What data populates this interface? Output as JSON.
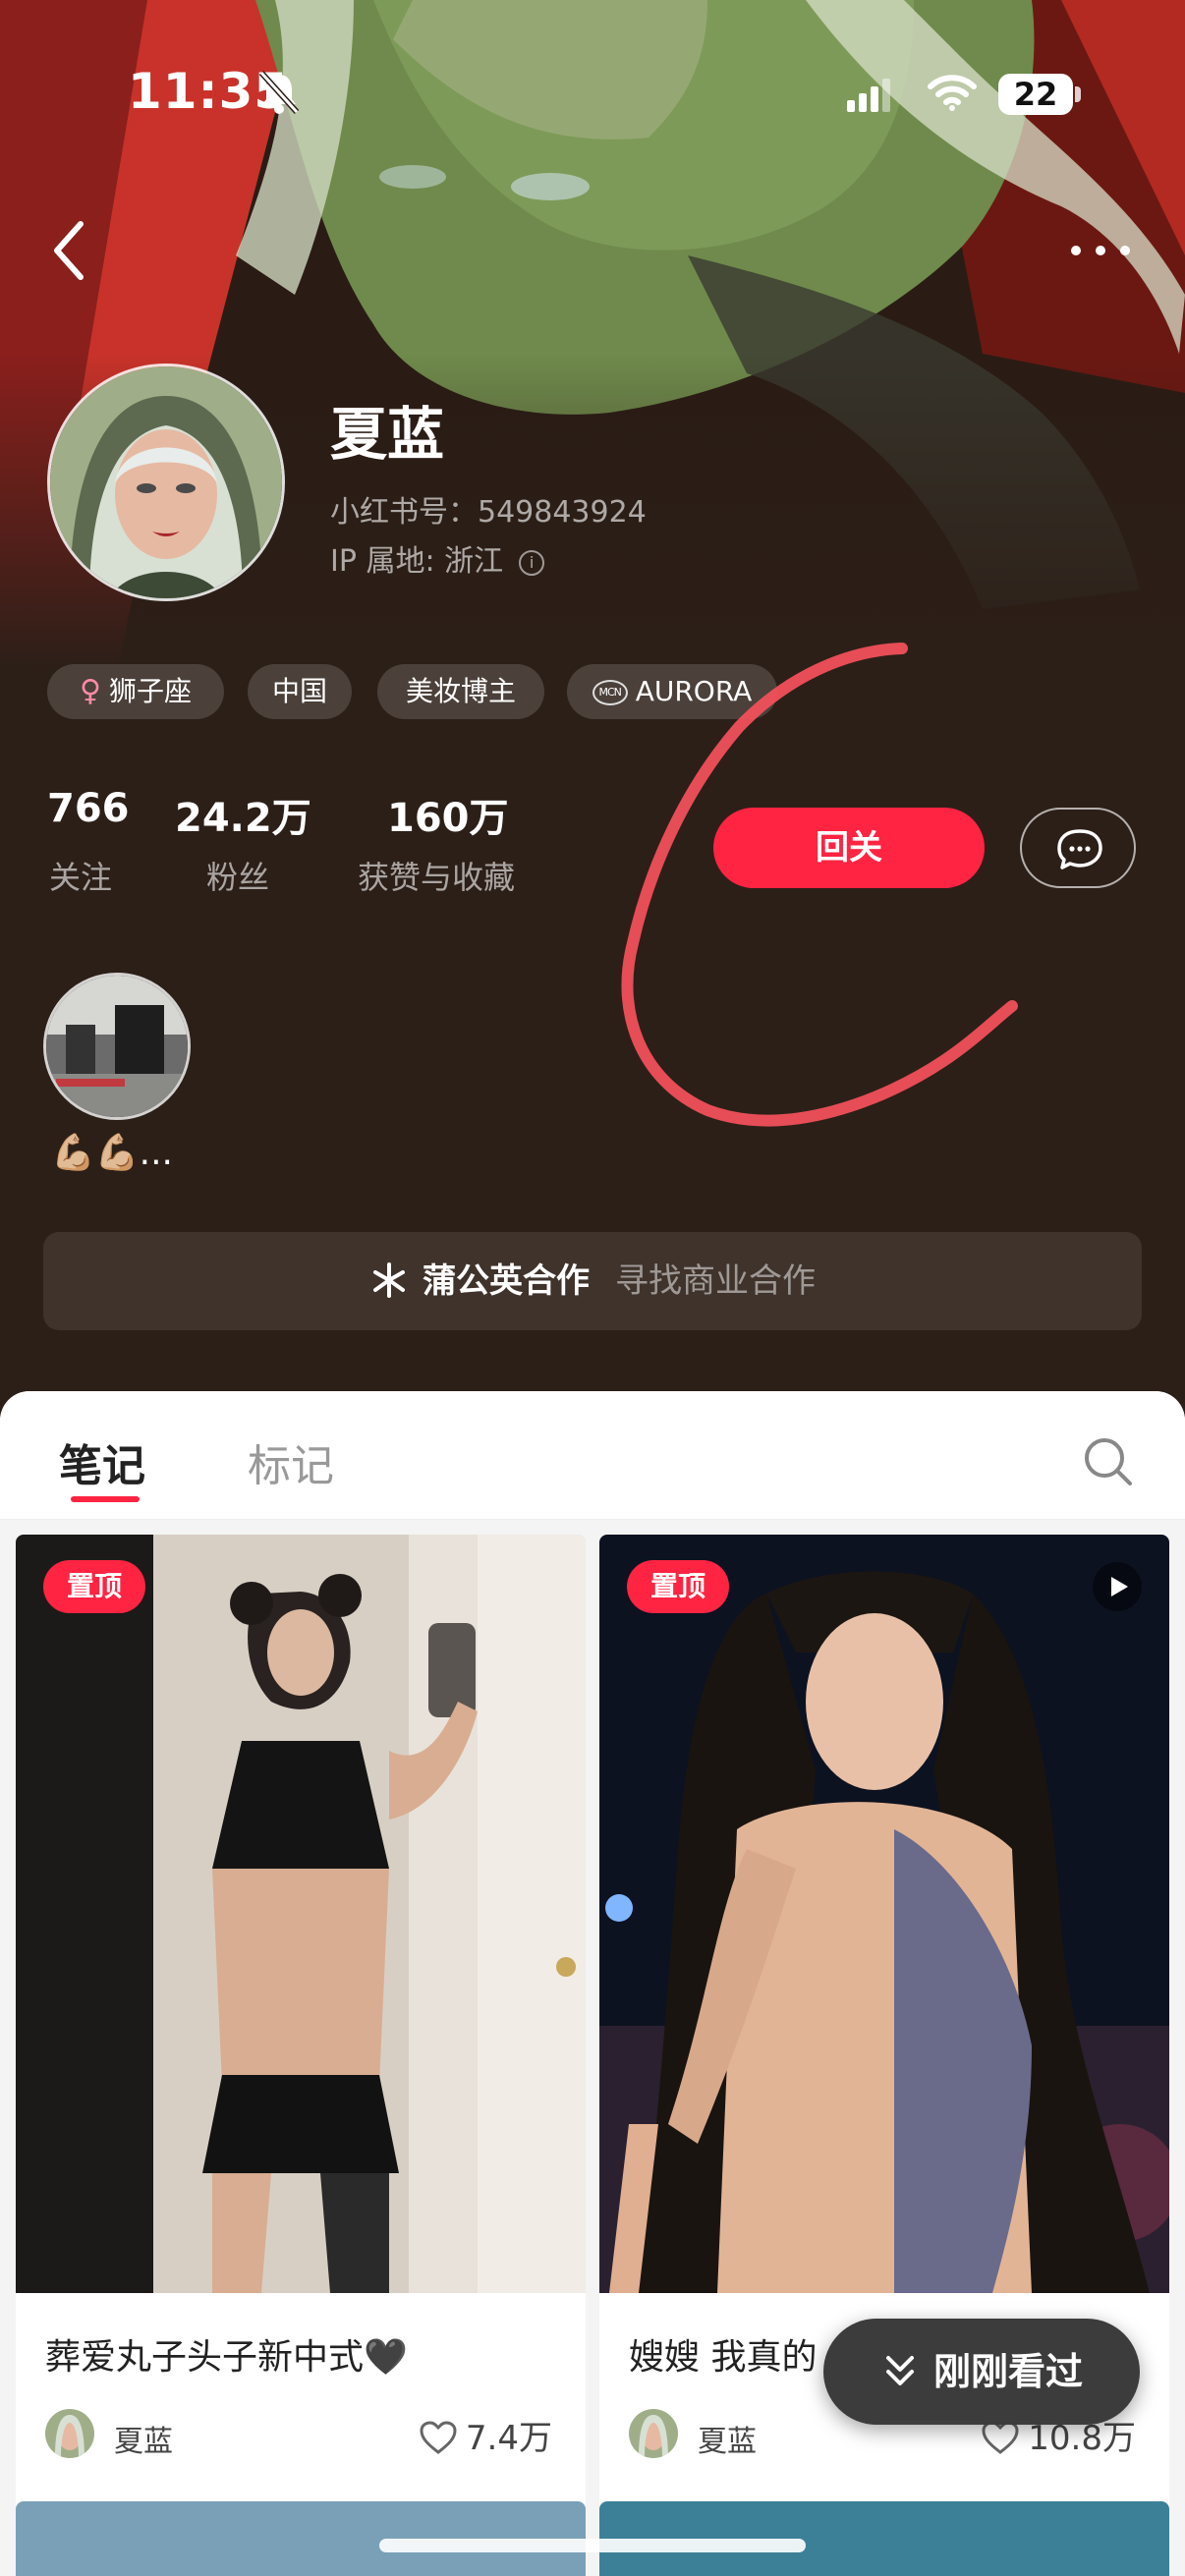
{
  "status_bar": {
    "time": "11:35",
    "battery": "22"
  },
  "profile": {
    "name": "夏蓝",
    "redbook_id": "小红书号：549843924",
    "ip_location": "IP 属地: 浙江",
    "tags": [
      {
        "label": "狮子座",
        "icon": "female-icon"
      },
      {
        "label": "中国"
      },
      {
        "label": "美妆博主"
      },
      {
        "label": "AURORA",
        "icon": "mcn-icon"
      }
    ]
  },
  "stats": [
    {
      "value": "766",
      "label": "关注"
    },
    {
      "value": "24.2万",
      "label": "粉丝"
    },
    {
      "value": "160万",
      "label": "获赞与收藏"
    }
  ],
  "actions": {
    "follow_back_label": "回关"
  },
  "highlight": {
    "caption": "💪🏼💪🏼..."
  },
  "collaboration": {
    "title": "蒲公英合作",
    "subtitle": "寻找商业合作"
  },
  "tabs": [
    {
      "label": "笔记",
      "active": true
    },
    {
      "label": "标记",
      "active": false
    }
  ],
  "notes": [
    {
      "pin_label": "置顶",
      "title": "葬爱丸子头子新中式🖤",
      "author": "夏蓝",
      "likes": "7.4万",
      "type": "image"
    },
    {
      "pin_label": "置顶",
      "title": "嫂嫂 我真的",
      "author": "夏蓝",
      "likes": "10.8万",
      "type": "video"
    }
  ],
  "recent_button_label": "刚刚看过",
  "colors": {
    "accent": "#ff2442",
    "header_bg": "#2c1f18",
    "annotation": "#f0505a"
  }
}
